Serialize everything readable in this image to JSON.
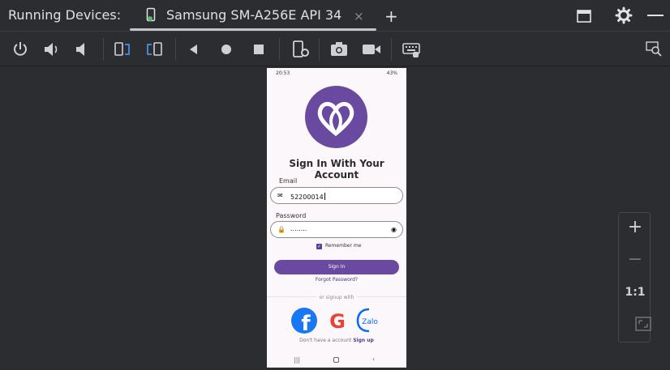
{
  "window": {
    "title": "Running Devices:",
    "tab_label": "Samsung SM-A256E API 34",
    "close_symbol": "×",
    "add_symbol": "+"
  },
  "toolbar": {
    "icons": [
      "power-icon",
      "volume-up-icon",
      "volume-down-icon",
      "rotate-left-icon",
      "rotate-right-icon",
      "back-icon",
      "home-icon",
      "overview-icon",
      "device-settings-icon",
      "camera-icon",
      "video-icon",
      "keyboard-icon",
      "inspect-icon"
    ]
  },
  "phone": {
    "status_time": "20:53",
    "status_battery": "43%",
    "headline": "Sign In With Your Account",
    "email_label": "Email",
    "email_value": "52200014",
    "password_label": "Password",
    "password_value": "........",
    "remember_label": "Remember me",
    "signin_label": "Sign In",
    "forgot_label": "Forgot Password?",
    "or_label": "or signup with",
    "bottom_text": "Don't have a account",
    "signup_label": "Sign up",
    "social": [
      "facebook-icon",
      "google-icon",
      "zalo-icon"
    ],
    "zalo_text": "Zalo",
    "facebook_letter": "f",
    "google_letter": "G"
  },
  "zoom": {
    "in": "+",
    "out": "−",
    "actual": "1:1"
  },
  "colors": {
    "accent": "#6a4aa1",
    "background": "#2b2d30",
    "facebook": "#1877f2",
    "zalo": "#0068ff"
  }
}
